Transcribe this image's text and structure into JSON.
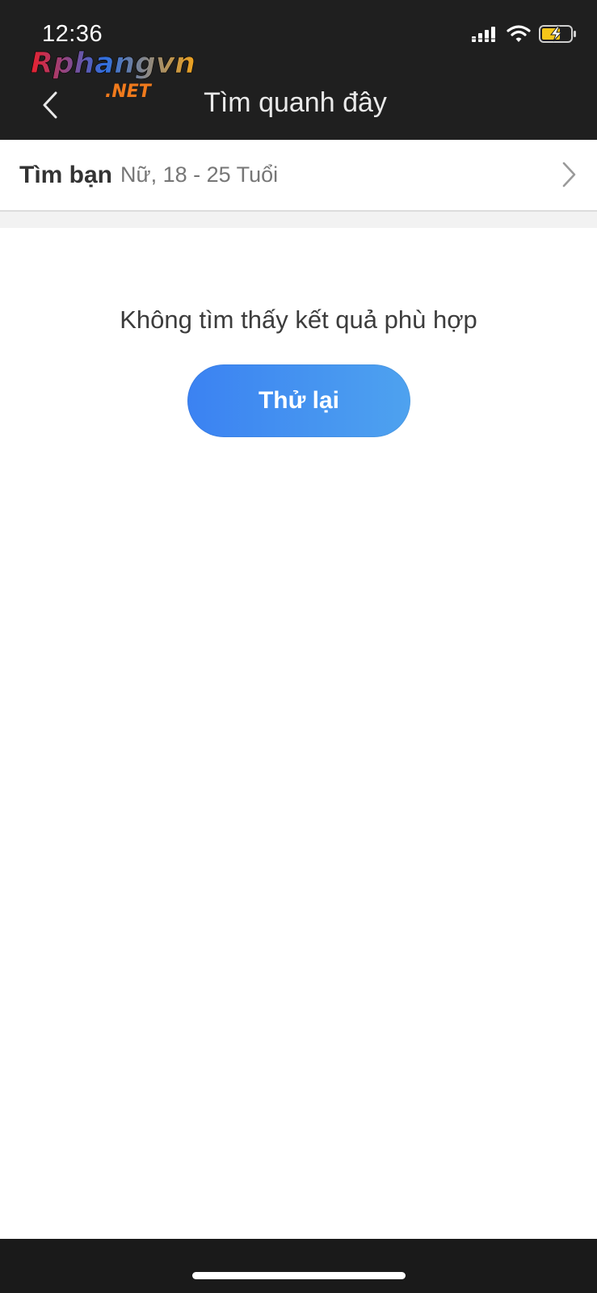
{
  "status_bar": {
    "time": "12:36",
    "signal_icon": "cellular-signal-icon",
    "wifi_icon": "wifi-icon",
    "battery_icon": "battery-charging-icon"
  },
  "watermark": {
    "brand": "Rphangvn",
    "suffix": ".NET"
  },
  "header": {
    "title": "Tìm quanh đây",
    "back_icon": "chevron-left-icon"
  },
  "filter": {
    "label": "Tìm bạn",
    "value": "Nữ, 18 - 25 Tuổi",
    "chevron_icon": "chevron-right-icon"
  },
  "empty_state": {
    "message": "Không tìm thấy kết quả phù hợp",
    "retry_label": "Thử lại"
  },
  "colors": {
    "header_bg": "#1f1f1f",
    "button_gradient_start": "#3b82f2",
    "button_gradient_end": "#4ea2ef",
    "battery_fill": "#f5c518"
  }
}
